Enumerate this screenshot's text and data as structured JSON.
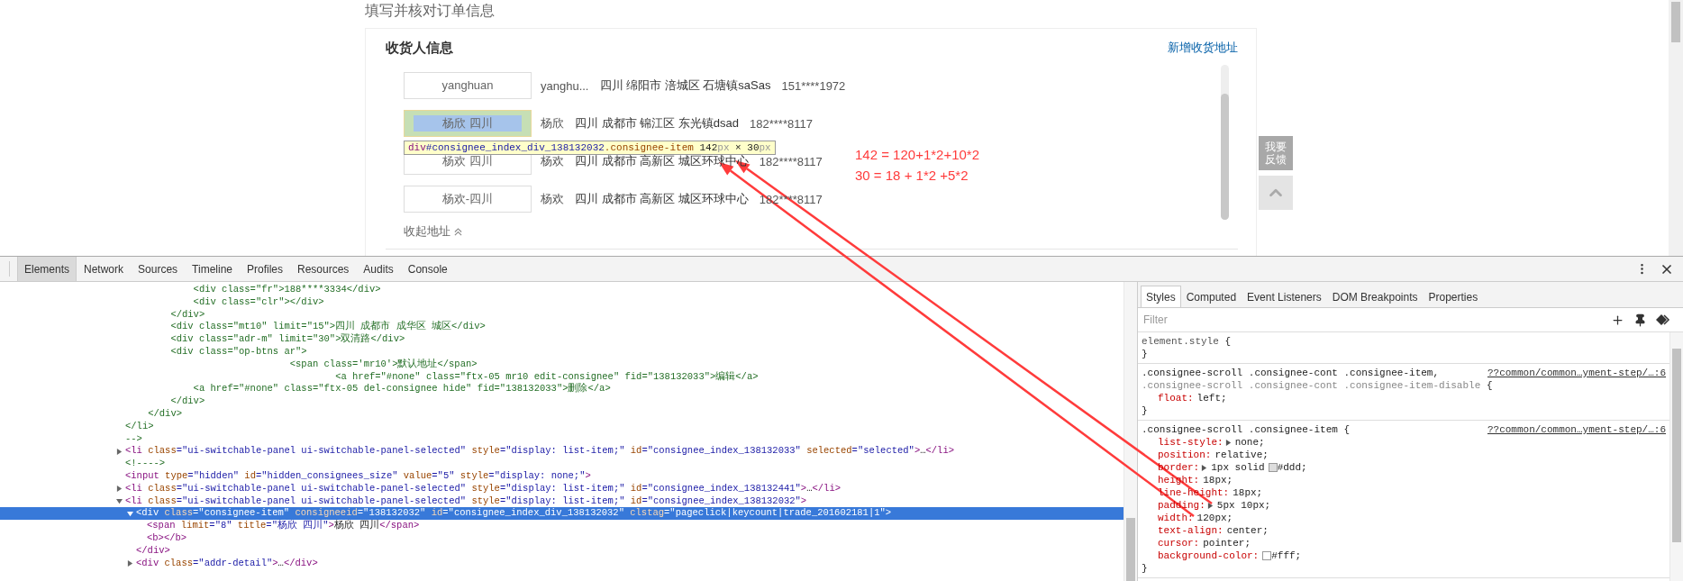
{
  "page": {
    "title": "填写并核对订单信息",
    "card": {
      "heading": "收货人信息",
      "add_link": "新增收货地址",
      "consignees": [
        {
          "button": "yanghuan",
          "name": "yanghu...",
          "address": "四川 绵阳市 涪城区 石塘镇saSas",
          "phone": "151****1972",
          "highlighted": false
        },
        {
          "button": "杨欣 四川",
          "name": "杨欣",
          "address": "四川 成都市 锦江区 东光镇dsad",
          "phone": "182****8117",
          "highlighted": true
        },
        {
          "button": "杨欢 四川",
          "name": "杨欢",
          "address": "四川 成都市 高新区 城区环球中心",
          "phone": "182****8117",
          "highlighted": false
        },
        {
          "button": "杨欢-四川",
          "name": "杨欢",
          "address": "四川 成都市 高新区 城区环球中心",
          "phone": "182****8117",
          "highlighted": false
        }
      ],
      "collapse_link": "收起地址"
    },
    "feedback": "我要反馈"
  },
  "inspect_tooltip": [
    {
      "kind": "tag",
      "text": "div"
    },
    {
      "kind": "id",
      "text": "#consignee_index_div_138132032"
    },
    {
      "kind": "class",
      "text": ".consignee-item"
    },
    {
      "kind": "num",
      "text": " 142"
    },
    {
      "kind": "unit",
      "text": "px"
    },
    {
      "kind": "sep",
      "text": " × "
    },
    {
      "kind": "num",
      "text": "30"
    },
    {
      "kind": "unit",
      "text": "px"
    }
  ],
  "annotation": [
    "142 = 120+1*2+10*2",
    "30 = 18 + 1*2 +5*2"
  ],
  "devtools": {
    "tabs": [
      {
        "label": "Elements",
        "selected": true
      },
      {
        "label": "Network",
        "selected": false
      },
      {
        "label": "Sources",
        "selected": false
      },
      {
        "label": "Timeline",
        "selected": false
      },
      {
        "label": "Profiles",
        "selected": false
      },
      {
        "label": "Resources",
        "selected": false
      },
      {
        "label": "Audits",
        "selected": false
      },
      {
        "label": "Console",
        "selected": false
      }
    ],
    "elements": {
      "comment_lines": [
        "            <div class=\"fr\">188****3334</div>",
        "            <div class=\"clr\"></div>",
        "        </div>",
        "        <div class=\"mt10\" limit=\"15\">四川 成都市 成华区 城区</div>",
        "        <div class=\"adr-m\" limit=\"30\">双清路</div>",
        "        <div class=\"op-btns ar\">",
        "                             <span class='mr10'>默认地址</span>",
        "                                     <a href=\"#none\" class=\"ftx-05 mr10 edit-consignee\" fid=\"138132033\">编辑</a>",
        "            <a href=\"#none\" class=\"ftx-05 del-consignee hide\" fid=\"138132033\">删除</a>",
        "        </div>",
        "    </div>",
        "</li>",
        "-->"
      ],
      "nodes": [
        {
          "expanded": false,
          "selected": false,
          "segments": [
            {
              "kind": "tag",
              "text": "<li"
            },
            {
              "kind": "attr",
              "text": " class"
            },
            {
              "kind": "value",
              "text": "=\"ui-switchable-panel ui-switchable-panel-selected\""
            },
            {
              "kind": "attr",
              "text": " style"
            },
            {
              "kind": "value",
              "text": "=\"display: list-item;\""
            },
            {
              "kind": "attr",
              "text": " id"
            },
            {
              "kind": "value",
              "text": "=\"consignee_index_138132033\""
            },
            {
              "kind": "attr",
              "text": " selected"
            },
            {
              "kind": "value",
              "text": "=\"selected\""
            },
            {
              "kind": "tag",
              "text": ">"
            },
            {
              "kind": "text",
              "text": "…"
            },
            {
              "kind": "tag",
              "text": "</li>"
            }
          ]
        },
        {
          "selected": false,
          "segments": [
            {
              "kind": "comment",
              "text": "<!---->"
            }
          ]
        },
        {
          "selected": false,
          "segments": [
            {
              "kind": "tag",
              "text": "<input"
            },
            {
              "kind": "attr",
              "text": " type"
            },
            {
              "kind": "value",
              "text": "=\"hidden\""
            },
            {
              "kind": "attr",
              "text": " id"
            },
            {
              "kind": "value",
              "text": "=\"hidden_consignees_size\""
            },
            {
              "kind": "attr",
              "text": " value"
            },
            {
              "kind": "value",
              "text": "=\"5\""
            },
            {
              "kind": "attr",
              "text": " style"
            },
            {
              "kind": "value",
              "text": "=\"display: none;\""
            },
            {
              "kind": "tag",
              "text": ">"
            }
          ]
        },
        {
          "expanded": false,
          "selected": false,
          "segments": [
            {
              "kind": "tag",
              "text": "<li"
            },
            {
              "kind": "attr",
              "text": " class"
            },
            {
              "kind": "value",
              "text": "=\"ui-switchable-panel ui-switchable-panel-selected\""
            },
            {
              "kind": "attr",
              "text": " style"
            },
            {
              "kind": "value",
              "text": "=\"display: list-item;\""
            },
            {
              "kind": "attr",
              "text": " id"
            },
            {
              "kind": "value",
              "text": "=\"consignee_index_138132441\""
            },
            {
              "kind": "tag",
              "text": ">"
            },
            {
              "kind": "text",
              "text": "…"
            },
            {
              "kind": "tag",
              "text": "</li>"
            }
          ]
        },
        {
          "expanded": true,
          "selected": false,
          "segments": [
            {
              "kind": "tag",
              "text": "<li"
            },
            {
              "kind": "attr",
              "text": " class"
            },
            {
              "kind": "value",
              "text": "=\"ui-switchable-panel ui-switchable-panel-selected\""
            },
            {
              "kind": "attr",
              "text": " style"
            },
            {
              "kind": "value",
              "text": "=\"display: list-item;\""
            },
            {
              "kind": "attr",
              "text": " id"
            },
            {
              "kind": "value",
              "text": "=\"consignee_index_138132032\""
            },
            {
              "kind": "tag",
              "text": ">"
            }
          ],
          "children": [
            {
              "expanded": true,
              "selected": true,
              "segments": [
                {
                  "kind": "tag",
                  "text": "<div"
                },
                {
                  "kind": "attr",
                  "text": " class"
                },
                {
                  "kind": "value",
                  "text": "=\"consignee-item\""
                },
                {
                  "kind": "attr",
                  "text": " consigneeid"
                },
                {
                  "kind": "value",
                  "text": "=\"138132032\""
                },
                {
                  "kind": "attr",
                  "text": " id"
                },
                {
                  "kind": "value",
                  "text": "=\"consignee_index_div_138132032\""
                },
                {
                  "kind": "attr",
                  "text": " clstag"
                },
                {
                  "kind": "value",
                  "text": "=\"pageclick|keycount|trade_201602181|1\""
                },
                {
                  "kind": "tag",
                  "text": ">"
                }
              ],
              "children": [
                {
                  "selected": false,
                  "segments": [
                    {
                      "kind": "tag",
                      "text": "<span"
                    },
                    {
                      "kind": "attr",
                      "text": " limit"
                    },
                    {
                      "kind": "value",
                      "text": "=\"8\""
                    },
                    {
                      "kind": "attr",
                      "text": " title"
                    },
                    {
                      "kind": "value",
                      "text": "=\"杨欣 四川\""
                    },
                    {
                      "kind": "tag",
                      "text": ">"
                    },
                    {
                      "kind": "text",
                      "text": "杨欣 四川"
                    },
                    {
                      "kind": "tag",
                      "text": "</span>"
                    }
                  ]
                },
                {
                  "selected": false,
                  "segments": [
                    {
                      "kind": "tag",
                      "text": "<b></b>"
                    }
                  ]
                }
              ],
              "closing": [
                {
                  "kind": "tag",
                  "text": "</div>"
                }
              ]
            },
            {
              "expanded": false,
              "selected": false,
              "segments": [
                {
                  "kind": "tag",
                  "text": "<div"
                },
                {
                  "kind": "attr",
                  "text": " class"
                },
                {
                  "kind": "value",
                  "text": "=\"addr-detail\""
                },
                {
                  "kind": "tag",
                  "text": ">"
                },
                {
                  "kind": "text",
                  "text": "…"
                },
                {
                  "kind": "tag",
                  "text": "</div>"
                }
              ]
            }
          ]
        }
      ]
    },
    "styles": {
      "tabs": [
        {
          "label": "Styles",
          "selected": true
        },
        {
          "label": "Computed",
          "selected": false
        },
        {
          "label": "Event Listeners",
          "selected": false
        },
        {
          "label": "DOM Breakpoints",
          "selected": false
        },
        {
          "label": "Properties",
          "selected": false
        }
      ],
      "filter_placeholder": "Filter",
      "rules": [
        {
          "kind": "inline",
          "selectors": [
            {
              "text": "element.style",
              "matched": true
            }
          ],
          "open": "{",
          "close": "}"
        },
        {
          "kind": "stylesheet",
          "source": "??common/common…yment-step/…:6",
          "selectors": [
            {
              "text": ".consignee-scroll .consignee-cont .consignee-item,",
              "matched": true
            },
            {
              "text": ".consignee-scroll .consignee-cont .consignee-item-disable",
              "matched": false
            }
          ],
          "open": "{",
          "properties": [
            {
              "name": "float:",
              "value": "left;",
              "expandable": false
            }
          ],
          "close": "}"
        },
        {
          "kind": "stylesheet",
          "source": "??common/common…yment-step/…:6",
          "selectors": [
            {
              "text": ".consignee-scroll .consignee-item",
              "matched": true
            }
          ],
          "open": "{",
          "properties": [
            {
              "name": "list-style:",
              "value": "none;",
              "expandable": true
            },
            {
              "name": "position:",
              "value": "relative;",
              "expandable": false
            },
            {
              "name": "border:",
              "value": "1px solid",
              "expandable": true,
              "color_value": "#ddd;"
            },
            {
              "name": "height:",
              "value": "18px;",
              "expandable": false
            },
            {
              "name": "line-height:",
              "value": "18px;",
              "expandable": false
            },
            {
              "name": "padding:",
              "value": "5px 10px;",
              "expandable": true
            },
            {
              "name": "width:",
              "value": "120px;",
              "expandable": false
            },
            {
              "name": "text-align:",
              "value": "center;",
              "expandable": false
            },
            {
              "name": "cursor:",
              "value": "pointer;",
              "expandable": false
            },
            {
              "name": "background-color:",
              "expandable": false,
              "color_value": "#fff;"
            }
          ],
          "close": "}"
        }
      ]
    }
  }
}
